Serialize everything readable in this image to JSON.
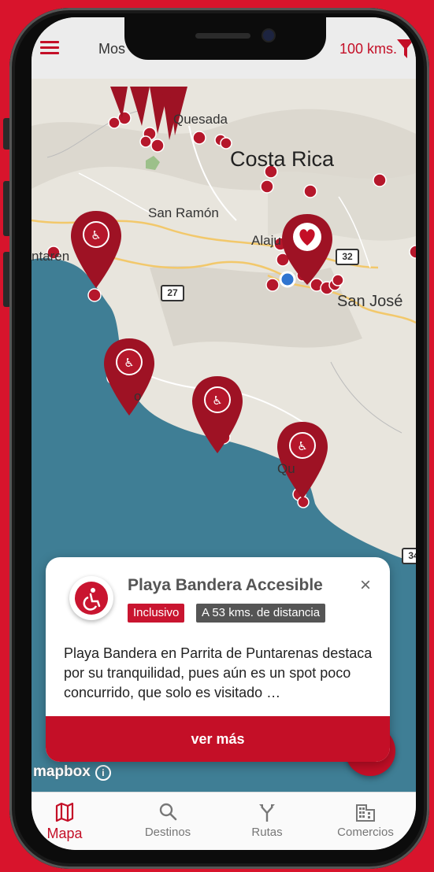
{
  "topbar": {
    "mode_label": "Mos",
    "radius_label": "100 kms."
  },
  "map": {
    "labels": {
      "quesada": "Quesada",
      "country": "Costa Rica",
      "san_ramon": "San Ramón",
      "alajuela": "Alaju",
      "puntarenas": "ntaren",
      "san_jose": "San José",
      "quepos": "Qu",
      "jaco": "o"
    },
    "road_shields": [
      "27",
      "32",
      "34"
    ],
    "attribution": "mapbox",
    "attribution_info": "i"
  },
  "card": {
    "title": "Playa Bandera Accesible",
    "close": "×",
    "badge_category": "Inclusivo",
    "badge_distance": "A 53 kms. de distancia",
    "description": "Playa Bandera en Parrita de Puntarenas destaca por su tranquilidad, pues aún es un spot poco concurrido, que solo es visitado …",
    "cta": "ver más"
  },
  "nav": {
    "items": [
      {
        "label": "Mapa",
        "icon": "map-icon",
        "active": true
      },
      {
        "label": "Destinos",
        "icon": "search-icon",
        "active": false
      },
      {
        "label": "Rutas",
        "icon": "route-icon",
        "active": false
      },
      {
        "label": "Comercios",
        "icon": "building-icon",
        "active": false
      }
    ]
  },
  "colors": {
    "brand_red": "#c40f27",
    "background_red": "#d8142c",
    "water": "#3f7e95",
    "badge_dark": "#555555"
  }
}
